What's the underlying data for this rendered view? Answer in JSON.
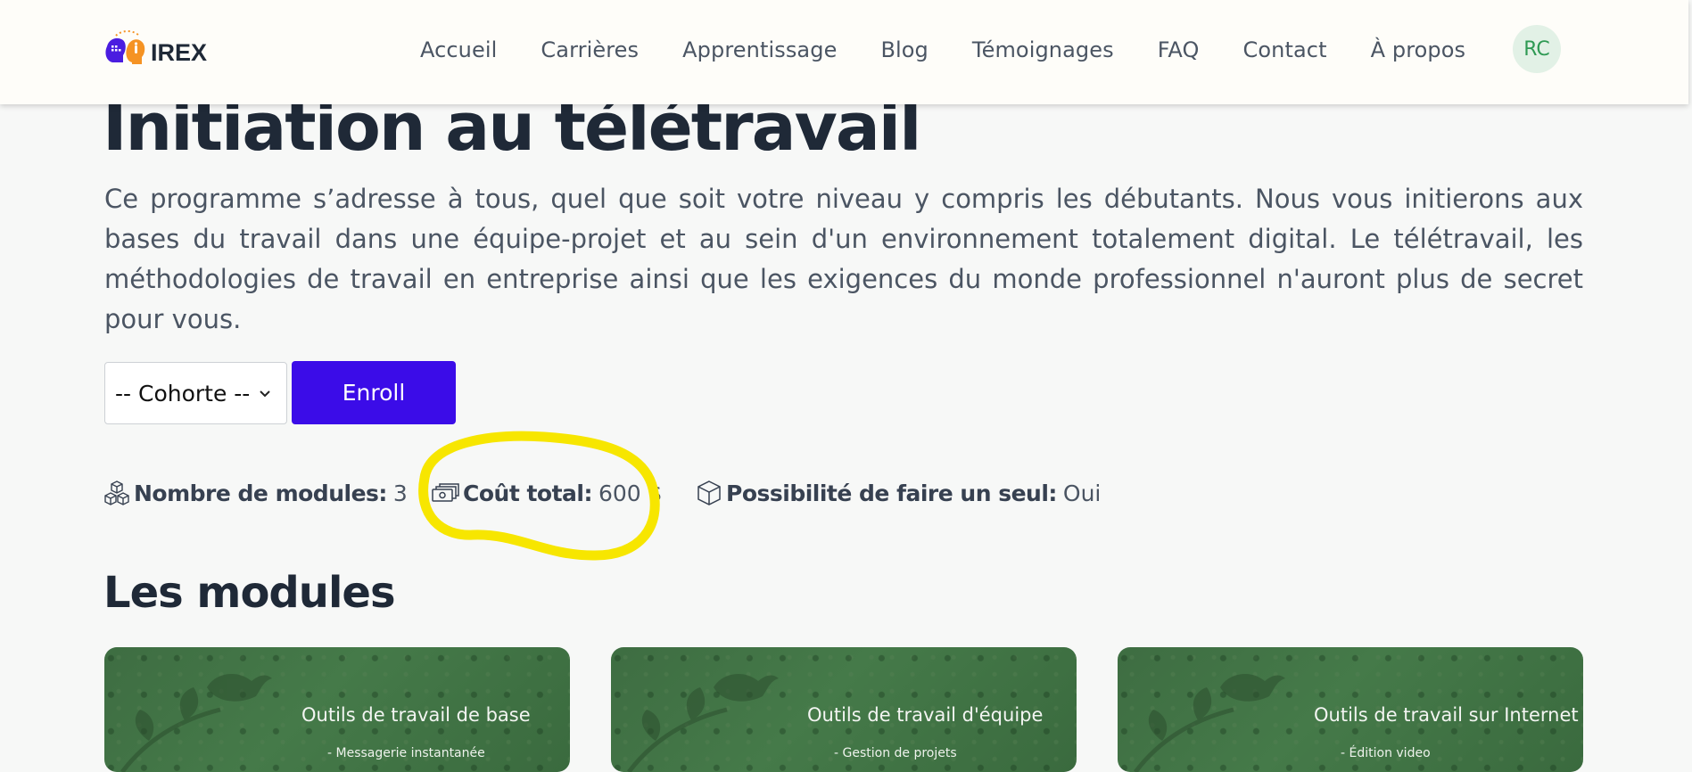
{
  "header": {
    "logo_text": "IREX",
    "nav": [
      "Accueil",
      "Carrières",
      "Apprentissage",
      "Blog",
      "Témoignages",
      "FAQ",
      "Contact",
      "À propos"
    ],
    "avatar_initials": "RC"
  },
  "program": {
    "title": "Initiation au télétravail",
    "description": "Ce programme s’adresse à tous, quel que soit votre niveau y compris les débutants. Nous vous initierons aux bases du travail dans une équipe-projet et au sein d'un environnement totalement digital. Le télétravail, les méthodologies de travail en entreprise ainsi que les exigences du monde professionnel n'auront plus de secret pour vous.",
    "cohort_select": {
      "selected": "-- Cohorte --"
    },
    "enroll_label": "Enroll"
  },
  "stats": {
    "modules": {
      "label": "Nombre de modules:",
      "value": "3",
      "icon": "cubes-icon"
    },
    "cost": {
      "label": "Coût total:",
      "value": "600 $",
      "icon": "money-icon"
    },
    "single": {
      "label": "Possibilité de faire un seul:",
      "value": "Oui",
      "icon": "box-icon"
    }
  },
  "modules_section": {
    "title": "Les modules",
    "cards": [
      {
        "title": "Outils de travail de base",
        "subtitle": "- Messagerie instantanée"
      },
      {
        "title": "Outils de travail d'équipe",
        "subtitle": "- Gestion de projets"
      },
      {
        "title": "Outils de travail sur Internet",
        "subtitle": "- Édition video"
      }
    ]
  },
  "colors": {
    "primary": "#3b0ce8",
    "highlight": "#f7e600",
    "heading": "#1f2937",
    "avatar_bg": "#e2f1e6",
    "avatar_text": "#2f9a54",
    "card_bg": "#3f6e42"
  }
}
